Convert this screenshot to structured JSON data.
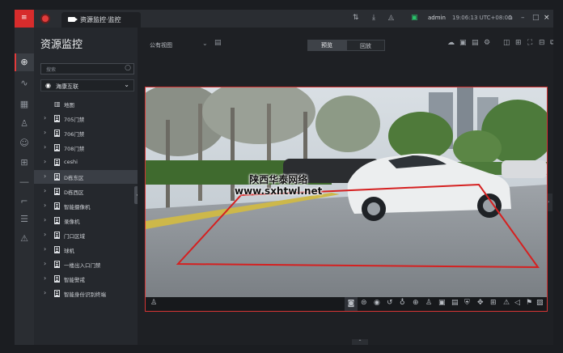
{
  "titlebar": {
    "tab_label": "资源监控·监控",
    "user": "admin",
    "time": "19:06:13 UTC+08:00",
    "icons": [
      "transfer-icon",
      "download-icon",
      "bell-icon",
      "event-icon",
      "lock-icon",
      "minimize-icon",
      "maximize-icon",
      "close-icon"
    ],
    "window_glyphs": {
      "lock": "⌂",
      "minimize": "–",
      "maximize": "□",
      "close": "×"
    }
  },
  "rail": {
    "icons": [
      "globe-icon",
      "pulse-icon",
      "grid-icon",
      "person-icon",
      "face-icon",
      "table-icon",
      "dash-icon",
      "barrier-icon",
      "list-icon",
      "alarm-icon"
    ]
  },
  "panel": {
    "title": "资源监控",
    "search_placeholder": "搜索",
    "selector_label": "海康互联",
    "tree": [
      {
        "label": "地图",
        "type": "map",
        "expandable": false
      },
      {
        "label": "705门禁",
        "type": "building",
        "expandable": true
      },
      {
        "label": "706门禁",
        "type": "building",
        "expandable": true
      },
      {
        "label": "708门禁",
        "type": "building",
        "expandable": true
      },
      {
        "label": "ceshi",
        "type": "building",
        "expandable": true
      },
      {
        "label": "D栋东区",
        "type": "building",
        "expandable": true,
        "selected": true
      },
      {
        "label": "D栋西区",
        "type": "building",
        "expandable": true
      },
      {
        "label": "智能摄像机",
        "type": "building",
        "expandable": true
      },
      {
        "label": "录像机",
        "type": "building",
        "expandable": true
      },
      {
        "label": "门口区域",
        "type": "building",
        "expandable": true
      },
      {
        "label": "球机",
        "type": "building",
        "expandable": true
      },
      {
        "label": "一楼出入口门禁",
        "type": "building",
        "expandable": true
      },
      {
        "label": "智能警戒",
        "type": "building",
        "expandable": true
      },
      {
        "label": "智能身份识别终端",
        "type": "building",
        "expandable": true
      }
    ]
  },
  "main": {
    "view_label": "公有视图",
    "tab_preview": "预览",
    "tab_playback": "回放",
    "toolbar_icons": [
      "cloud-icon",
      "save-view-icon",
      "doc-icon",
      "settings-icon",
      "window-icon",
      "layout-grid-icon",
      "fullscreen-icon",
      "split-icon",
      "popout-icon"
    ],
    "video_toolbar_icons": [
      "snapshot-icon",
      "record-icon",
      "instant-playback-icon",
      "rewind-icon",
      "mic-icon",
      "zoom-icon",
      "person-icon",
      "screen-icon",
      "intercom-icon",
      "shield-icon",
      "ptz-icon",
      "grid-icon",
      "alarm-icon",
      "volume-icon",
      "bookmark-icon",
      "image-icon"
    ]
  },
  "watermark": {
    "line1": "陕西华泰网络",
    "line2": "www.sxhtwl.net"
  },
  "colors": {
    "accent": "#d72c2c",
    "panel_bg": "#25282d",
    "selected_bg": "#3a3e45",
    "detection_line": "#d52020"
  }
}
